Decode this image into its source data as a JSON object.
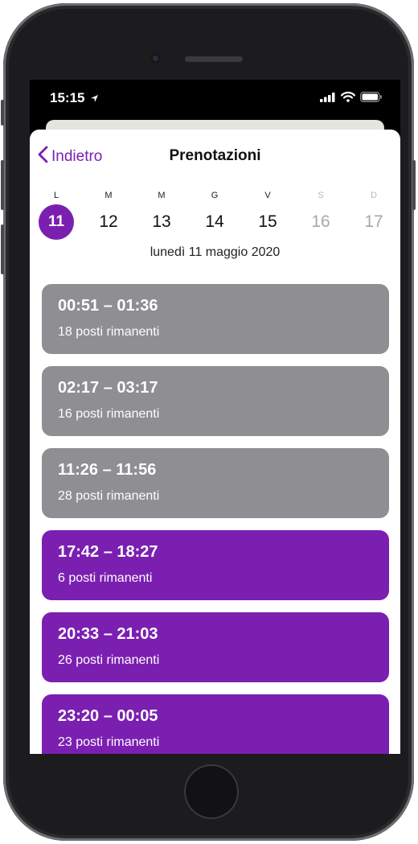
{
  "status_bar": {
    "time": "15:15"
  },
  "nav": {
    "back_label": "Indietro",
    "title": "Prenotazioni"
  },
  "calendar": {
    "days": [
      {
        "weekday": "L",
        "day": "11",
        "state": "selected"
      },
      {
        "weekday": "M",
        "day": "12",
        "state": "normal"
      },
      {
        "weekday": "M",
        "day": "13",
        "state": "normal"
      },
      {
        "weekday": "G",
        "day": "14",
        "state": "normal"
      },
      {
        "weekday": "V",
        "day": "15",
        "state": "normal"
      },
      {
        "weekday": "S",
        "day": "16",
        "state": "disabled"
      },
      {
        "weekday": "D",
        "day": "17",
        "state": "disabled"
      }
    ],
    "selected_date_label": "lunedì 11 maggio 2020"
  },
  "slots": [
    {
      "range": "00:51 – 01:36",
      "seats": "18 posti rimanenti",
      "status": "past"
    },
    {
      "range": "02:17 – 03:17",
      "seats": "16 posti rimanenti",
      "status": "past"
    },
    {
      "range": "11:26 – 11:56",
      "seats": "28 posti rimanenti",
      "status": "past"
    },
    {
      "range": "17:42 – 18:27",
      "seats": "6 posti rimanenti",
      "status": "available"
    },
    {
      "range": "20:33 – 21:03",
      "seats": "26 posti rimanenti",
      "status": "available"
    },
    {
      "range": "23:20 – 00:05",
      "seats": "23 posti rimanenti",
      "status": "available"
    }
  ],
  "colors": {
    "accent": "#7b1fb1",
    "past_slot": "#8e8e93"
  },
  "icons": {
    "back": "chevron-left-icon",
    "location": "location-arrow-icon",
    "signal": "cellular-signal-icon",
    "wifi": "wifi-icon",
    "battery": "battery-icon"
  }
}
